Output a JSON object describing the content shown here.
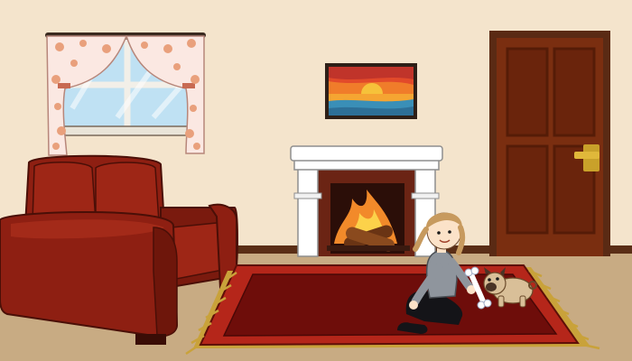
{
  "scene": {
    "description_visible_text": [],
    "objects": [
      {
        "id": "window",
        "icon": "window-with-floral-curtains-icon"
      },
      {
        "id": "painting",
        "icon": "sunset-painting-icon"
      },
      {
        "id": "fireplace",
        "icon": "fireplace-icon"
      },
      {
        "id": "door",
        "icon": "wooden-door-icon"
      },
      {
        "id": "sofa",
        "icon": "red-sofa-icon"
      },
      {
        "id": "rug",
        "icon": "red-rug-icon"
      },
      {
        "id": "girl",
        "icon": "girl-character-icon"
      },
      {
        "id": "bone",
        "icon": "dog-bone-icon"
      },
      {
        "id": "dog",
        "icon": "pug-dog-icon"
      }
    ]
  },
  "colors": {
    "wall": "#f4e4cc",
    "floor": "#c8ab83",
    "baseboard": "#5a2e16",
    "sofa": "#8e1f12",
    "sofa_dark": "#5e1309",
    "rug_outer": "#b5261a",
    "rug_inner": "#6e0d0a",
    "fringe": "#c9a23a",
    "door": "#7a2e10",
    "door_dark": "#551c07",
    "mantel": "#ffffff",
    "fire_brick": "#6b2414",
    "curtain": "#fbe8e2",
    "curtain_flower": "#e9a07c",
    "sky": "#bfe1f3"
  }
}
